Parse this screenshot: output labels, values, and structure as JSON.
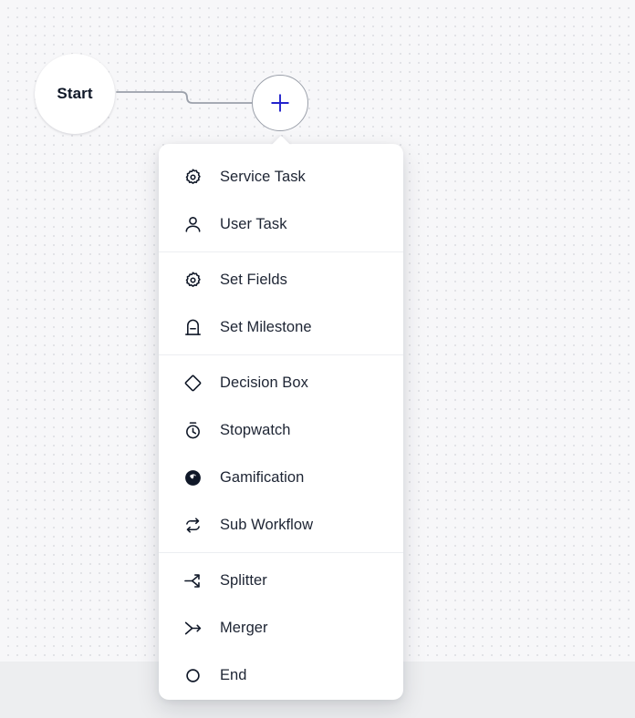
{
  "canvas": {
    "background_color": "#f7f7f9",
    "dot_color": "#e2e3e7",
    "footer_color": "#edeef0"
  },
  "start_node": {
    "label": "Start",
    "name": "start-node"
  },
  "add_node_button": {
    "icon": "plus-icon",
    "accent_color": "#2222cc",
    "border_color": "#9ba0aa"
  },
  "node_menu": {
    "groups": [
      {
        "items": [
          {
            "label": "Service Task",
            "icon": "gear-icon"
          },
          {
            "label": "User Task",
            "icon": "user-icon"
          }
        ]
      },
      {
        "items": [
          {
            "label": "Set Fields",
            "icon": "gear-icon"
          },
          {
            "label": "Set Milestone",
            "icon": "milestone-icon"
          }
        ]
      },
      {
        "items": [
          {
            "label": "Decision Box",
            "icon": "diamond-icon"
          },
          {
            "label": "Stopwatch",
            "icon": "stopwatch-icon"
          },
          {
            "label": "Gamification",
            "icon": "gamification-icon"
          },
          {
            "label": "Sub Workflow",
            "icon": "sub-workflow-icon"
          }
        ]
      },
      {
        "items": [
          {
            "label": "Splitter",
            "icon": "splitter-icon"
          },
          {
            "label": "Merger",
            "icon": "merger-icon"
          },
          {
            "label": "End",
            "icon": "circle-icon"
          }
        ]
      }
    ]
  }
}
